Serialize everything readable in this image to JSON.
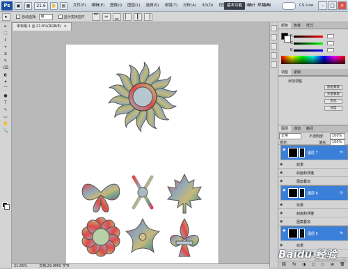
{
  "menubar": {
    "logo": "Ps",
    "zoom": "21.6",
    "menus": [
      "文件(F)",
      "编辑(E)",
      "图像(I)",
      "图层(L)",
      "选择(S)",
      "滤镜(T)",
      "分析(A)",
      "3D(D)",
      "视图(V)",
      "窗口(W)",
      "帮助(H)"
    ],
    "workspace_active": "基本功能",
    "workspaces": [
      "设计",
      "绘画"
    ],
    "cs_live": "CS Live",
    "win_min": "–",
    "win_max": "□",
    "win_close": "×"
  },
  "options": {
    "auto_select_label": "自动选择:",
    "auto_select_value": "组",
    "show_transform": "显示变换控件"
  },
  "tools": [
    "▸",
    "⬚",
    "ℓ",
    "⌖",
    "⧄",
    "✎",
    "⌫",
    "◐",
    "✦",
    "⌒",
    "●",
    "T",
    "↖",
    "▭",
    "✋",
    "🔍"
  ],
  "document": {
    "tab_label": "未标题-1 @ 21.6%(RGB/8)",
    "tab_close": "×",
    "status_zoom": "21.65%",
    "status_doc": "文档:29.9M/0 字节"
  },
  "panels": {
    "tabs_top": [
      "颜色",
      "色板",
      "样式"
    ],
    "color_labels": [
      "R",
      "G",
      "B"
    ],
    "tabs_adj": [
      "调整",
      "蒙版"
    ],
    "adj_title": "添加调整",
    "adj_buttons": [
      "图层蒙版",
      "矢量蒙版",
      "羽化",
      "浓度"
    ],
    "tabs_layers": [
      "图层",
      "通道",
      "路径"
    ],
    "blend_mode": "正常",
    "opacity_label": "不透明度:",
    "opacity_value": "100%",
    "fill_label": "填充:",
    "fill_value": "100%",
    "lock_label": "锁定:"
  },
  "layers": [
    {
      "name": "图层 7",
      "kind": "big",
      "selected": true
    },
    {
      "name": "效果",
      "kind": "sub"
    },
    {
      "name": "斜面和浮雕",
      "kind": "sub"
    },
    {
      "name": "图案叠加",
      "kind": "sub"
    },
    {
      "name": "图层 6",
      "kind": "big",
      "selected": true
    },
    {
      "name": "效果",
      "kind": "sub"
    },
    {
      "name": "斜面和浮雕",
      "kind": "sub"
    },
    {
      "name": "图案叠加",
      "kind": "sub"
    },
    {
      "name": "图层 5",
      "kind": "big",
      "selected": true
    },
    {
      "name": "效果",
      "kind": "sub"
    },
    {
      "name": "斜面和浮雕",
      "kind": "sub"
    }
  ],
  "layers_footer": [
    "⛓",
    "fx",
    "◑",
    "◻",
    "▭",
    "⊞",
    "🗑"
  ],
  "watermark": {
    "text": "Baidu 经验",
    "sub": "jingyan.baidu.com"
  },
  "colors": {
    "selected_row": "#3a7fd8",
    "ps_blue": "#1b4f9e"
  }
}
